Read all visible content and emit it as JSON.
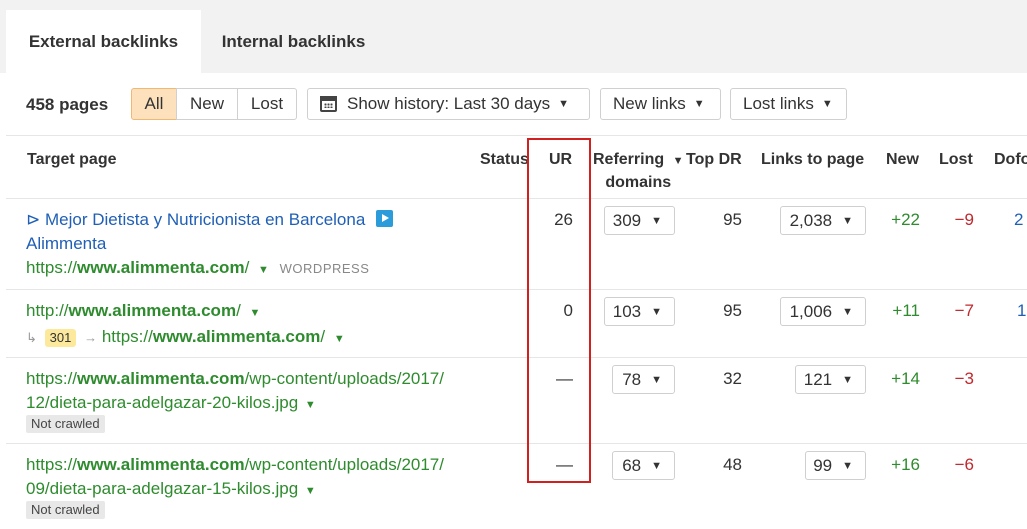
{
  "tabs": [
    {
      "label": "External backlinks",
      "active": true
    },
    {
      "label": "Internal backlinks",
      "active": false
    }
  ],
  "toolbar": {
    "page_count": "458 pages",
    "filter_all": "All",
    "filter_new": "New",
    "filter_lost": "Lost",
    "history_label": "Show history: Last 30 days",
    "new_links_label": "New links",
    "lost_links_label": "Lost links"
  },
  "columns": {
    "target_page": "Target page",
    "status": "Status",
    "ur": "UR",
    "referring_domains_line1": "Referring",
    "referring_domains_line2": "domains",
    "top_dr": "Top DR",
    "links_to_page": "Links to page",
    "new": "New",
    "lost": "Lost",
    "dofollow": "Dofo"
  },
  "rows": [
    {
      "title_line1": "Mejor Dietista y Nutricionista en Barcelona",
      "title_line2": "Alimmenta",
      "url_prefix": "https://",
      "url_bold": "www.alimmenta.com",
      "url_suffix": "/",
      "platform": "WORDPRESS",
      "ur": "26",
      "referring_domains": "309",
      "top_dr": "95",
      "links_to_page": "2,038",
      "new": "+22",
      "lost": "−9",
      "dofollow": "2"
    },
    {
      "url_prefix": "http://",
      "url_bold": "www.alimmenta.com",
      "url_suffix": "/",
      "redirect_code": "301",
      "redirect_prefix": "https://",
      "redirect_bold": "www.alimmenta.com",
      "redirect_suffix": "/",
      "ur": "0",
      "referring_domains": "103",
      "top_dr": "95",
      "links_to_page": "1,006",
      "new": "+11",
      "lost": "−7",
      "dofollow": "1"
    },
    {
      "url_prefix": "https://",
      "url_bold": "www.alimmenta.com",
      "url_suffix": "/wp-content/uploads/2017/",
      "url_line2": "12/dieta-para-adelgazar-20-kilos.jpg",
      "crawl_status": "Not crawled",
      "ur": "—",
      "referring_domains": "78",
      "top_dr": "32",
      "links_to_page": "121",
      "new": "+14",
      "lost": "−3"
    },
    {
      "url_prefix": "https://",
      "url_bold": "www.alimmenta.com",
      "url_suffix": "/wp-content/uploads/2017/",
      "url_line2": "09/dieta-para-adelgazar-15-kilos.jpg",
      "crawl_status": "Not crawled",
      "ur": "—",
      "referring_domains": "68",
      "top_dr": "48",
      "links_to_page": "99",
      "new": "+16",
      "lost": "−6"
    }
  ],
  "colors": {
    "link_blue": "#1f5fb6",
    "url_green": "#2e8b2e",
    "positive": "#2e8b2e",
    "negative": "#c0282d",
    "active_filter_bg": "#fde1bd",
    "highlight_border": "#d0201f"
  }
}
